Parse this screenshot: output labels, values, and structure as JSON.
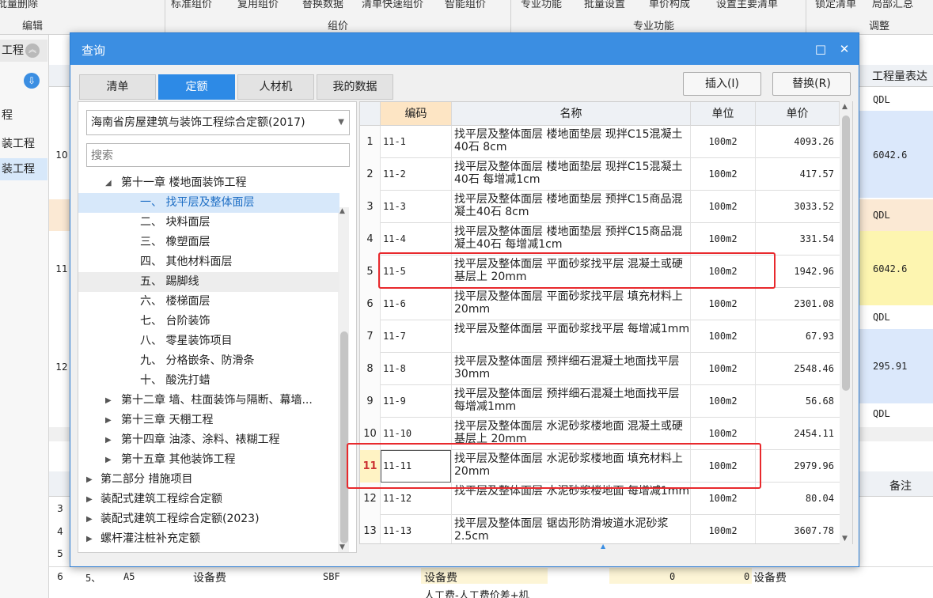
{
  "ribbon": {
    "top_items": [
      "批量删除",
      "标准组价",
      "复用组价",
      "替换数据",
      "清单快速组价",
      "智能组价",
      "专业功能",
      "批量设置",
      "单价构成",
      "设置主要清单",
      "锁定清单",
      "局部汇总"
    ],
    "groups": [
      "编辑",
      "组价",
      "专业功能",
      "调整"
    ]
  },
  "left_tree": {
    "header": "工程",
    "items": [
      "程",
      "装工程",
      "装工程"
    ]
  },
  "background_grid": {
    "header_right": "工程量表达",
    "col_note": "备注",
    "side_rows": [
      {
        "num": "10",
        "qdl": "QDL",
        "val": "6042.6"
      },
      {
        "num": "11",
        "qdl": "QDL",
        "val": "6042.6"
      },
      {
        "num": "12",
        "qdl": "QDL",
        "val": "295.91"
      }
    ],
    "extra_qdl": "QDL",
    "bottom_nums": [
      "3",
      "4",
      "5"
    ],
    "row6": {
      "num": "6",
      "idx": "5、",
      "code": "A5",
      "name": "设备费",
      "abbr": "SBF",
      "name2": "设备费",
      "v1": "0",
      "v2": "0",
      "name3": "设备费"
    },
    "row7": {
      "name": "人工费-人工费价差+机"
    }
  },
  "dialog": {
    "title": "查询",
    "maximize_icon": "□",
    "close_icon": "✕",
    "tabs": [
      "清单",
      "定额",
      "人材机",
      "我的数据"
    ],
    "active_tab": 1,
    "insert_btn": "插入(I)",
    "replace_btn": "替换(R)",
    "quota_select": "海南省房屋建筑与装饰工程综合定额(2017)",
    "search_placeholder": "搜索",
    "tree": [
      {
        "label": "第十一章 楼地面装饰工程",
        "indent": 1,
        "arrow": "down"
      },
      {
        "label": "一、 找平层及整体面层",
        "indent": 2,
        "arrow": "",
        "state": "sel"
      },
      {
        "label": "二、 块料面层",
        "indent": 2,
        "arrow": ""
      },
      {
        "label": "三、 橡塑面层",
        "indent": 2,
        "arrow": ""
      },
      {
        "label": "四、 其他材料面层",
        "indent": 2,
        "arrow": ""
      },
      {
        "label": "五、 踢脚线",
        "indent": 2,
        "arrow": "",
        "state": "hl"
      },
      {
        "label": "六、 楼梯面层",
        "indent": 2,
        "arrow": ""
      },
      {
        "label": "七、 台阶装饰",
        "indent": 2,
        "arrow": ""
      },
      {
        "label": "八、 零星装饰项目",
        "indent": 2,
        "arrow": ""
      },
      {
        "label": "九、 分格嵌条、防滑条",
        "indent": 2,
        "arrow": ""
      },
      {
        "label": "十、 酸洗打蜡",
        "indent": 2,
        "arrow": ""
      },
      {
        "label": "第十二章 墙、柱面装饰与隔断、幕墙...",
        "indent": 1,
        "arrow": "right"
      },
      {
        "label": "第十三章 天棚工程",
        "indent": 1,
        "arrow": "right"
      },
      {
        "label": "第十四章 油漆、涂料、裱糊工程",
        "indent": 1,
        "arrow": "right"
      },
      {
        "label": "第十五章 其他装饰工程",
        "indent": 1,
        "arrow": "right"
      },
      {
        "label": "第二部分 措施项目",
        "indent": 0,
        "arrow": "right"
      },
      {
        "label": "装配式建筑工程综合定额",
        "indent": 0,
        "arrow": "right"
      },
      {
        "label": "装配式建筑工程综合定额(2023)",
        "indent": 0,
        "arrow": "right"
      },
      {
        "label": "螺杆灌注桩补充定额",
        "indent": 0,
        "arrow": "right"
      }
    ],
    "table_headers": [
      "编码",
      "名称",
      "单位",
      "单价"
    ],
    "rows": [
      {
        "num": "1",
        "code": "11-1",
        "name": "找平层及整体面层 楼地面垫层 现拌C15混凝土40石 8cm",
        "unit": "100m2",
        "price": "4093.26"
      },
      {
        "num": "2",
        "code": "11-2",
        "name": "找平层及整体面层 楼地面垫层 现拌C15混凝土40石 每增减1cm",
        "unit": "100m2",
        "price": "417.57"
      },
      {
        "num": "3",
        "code": "11-3",
        "name": "找平层及整体面层 楼地面垫层 预拌C15商品混凝土40石 8cm",
        "unit": "100m2",
        "price": "3033.52"
      },
      {
        "num": "4",
        "code": "11-4",
        "name": "找平层及整体面层 楼地面垫层 预拌C15商品混凝土40石 每增减1cm",
        "unit": "100m2",
        "price": "331.54"
      },
      {
        "num": "5",
        "code": "11-5",
        "name": "找平层及整体面层 平面砂浆找平层 混凝土或硬基层上 20mm",
        "unit": "100m2",
        "price": "1942.96"
      },
      {
        "num": "6",
        "code": "11-6",
        "name": "找平层及整体面层 平面砂浆找平层 填充材料上 20mm",
        "unit": "100m2",
        "price": "2301.08"
      },
      {
        "num": "7",
        "code": "11-7",
        "name": "找平层及整体面层 平面砂浆找平层 每增减1mm",
        "unit": "100m2",
        "price": "67.93"
      },
      {
        "num": "8",
        "code": "11-8",
        "name": "找平层及整体面层 预拌细石混凝土地面找平层 30mm",
        "unit": "100m2",
        "price": "2548.46"
      },
      {
        "num": "9",
        "code": "11-9",
        "name": "找平层及整体面层 预拌细石混凝土地面找平层 每增减1mm",
        "unit": "100m2",
        "price": "56.68"
      },
      {
        "num": "10",
        "code": "11-10",
        "name": "找平层及整体面层 水泥砂浆楼地面 混凝土或硬基层上 20mm",
        "unit": "100m2",
        "price": "2454.11"
      },
      {
        "num": "11",
        "code": "11-11",
        "name": "找平层及整体面层 水泥砂浆楼地面 填充材料上 20mm",
        "unit": "100m2",
        "price": "2979.96"
      },
      {
        "num": "12",
        "code": "11-12",
        "name": "找平层及整体面层 水泥砂浆楼地面 每增减1mm",
        "unit": "100m2",
        "price": "80.04"
      },
      {
        "num": "13",
        "code": "11-13",
        "name": "找平层及整体面层 锯齿形防滑坡道水泥砂浆2.5cm",
        "unit": "100m2",
        "price": "3607.78"
      }
    ],
    "selected_row": 10,
    "highlight_rows": [
      4,
      10
    ]
  },
  "colors": {
    "accent": "#3b8ee2",
    "highlight": "#e8292d",
    "selected_tree_bg": "#d7e8fa"
  }
}
